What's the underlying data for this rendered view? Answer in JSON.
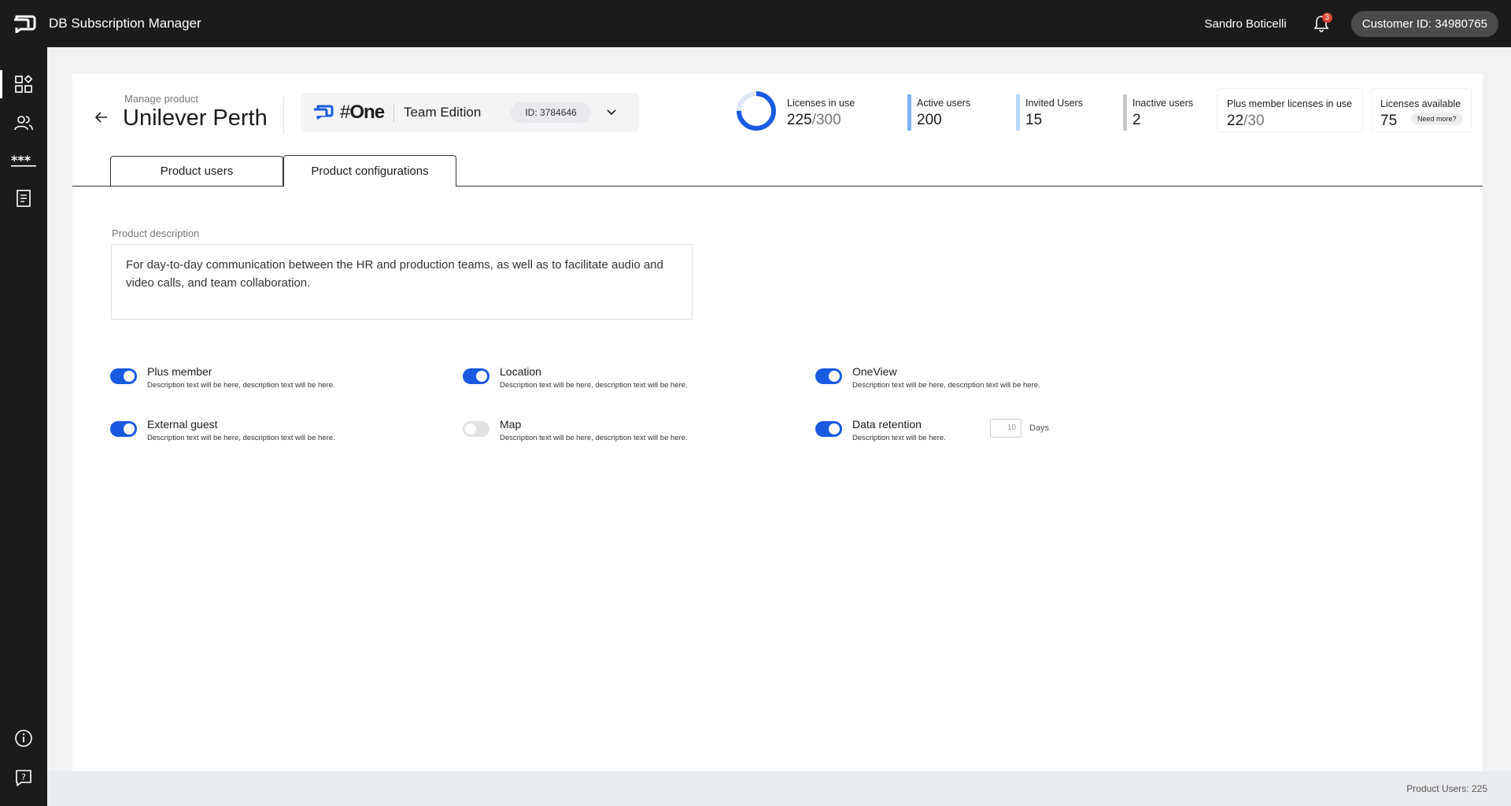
{
  "app": {
    "title": "DB Subscription Manager"
  },
  "header": {
    "user_name": "Sandro Boticelli",
    "notifications_count": "3",
    "customer_id": "Customer ID: 34980765"
  },
  "sidebar": {
    "items": [
      {
        "icon": "dashboard-icon"
      },
      {
        "icon": "users-icon"
      },
      {
        "icon": "password-icon"
      },
      {
        "icon": "invoice-icon"
      }
    ],
    "bottom": [
      {
        "icon": "info-icon"
      },
      {
        "icon": "help-icon"
      }
    ]
  },
  "product": {
    "manage_label": "Manage product",
    "name": "Unilever Perth",
    "brand_hash": "#",
    "brand_one": "One",
    "edition": "Team Edition",
    "id_label": "ID: 3784646"
  },
  "stats": {
    "licenses": {
      "label": "Licenses in use",
      "used": "225",
      "total": "/300",
      "fraction": 0.75
    },
    "active": {
      "label": "Active users",
      "value": "200"
    },
    "invited": {
      "label": "Invited Users",
      "value": "15"
    },
    "inactive": {
      "label": "Inactive users",
      "value": "2"
    },
    "plus": {
      "label": "Plus member licenses in use",
      "used": "22",
      "total": "/30"
    },
    "available": {
      "label": "Licenses available",
      "value": "75",
      "need_more": "Need more?"
    }
  },
  "colors": {
    "accent": "#1a5ae0",
    "active_bar": "#7fb3f5",
    "invited_bar": "#b9d6fb",
    "inactive_bar": "#c8c8c8"
  },
  "tabs": [
    {
      "label": "Product users",
      "active": false
    },
    {
      "label": "Product configurations",
      "active": true
    }
  ],
  "description": {
    "label": "Product description",
    "text": "For day-to-day communication between the HR and production teams, as well as to facilitate audio and video calls, and team collaboration."
  },
  "options": [
    {
      "name": "Plus member",
      "desc": "Description text will be here, description text will be here.",
      "on": true
    },
    {
      "name": "Location",
      "desc": "Description text will be here, description text will be here.",
      "on": true
    },
    {
      "name": "OneView",
      "desc": "Description text will be here, description text will be here.",
      "on": true
    },
    {
      "name": "External guest",
      "desc": "Description text will be here, description text will be here.",
      "on": true
    },
    {
      "name": "Map",
      "desc": "Description text will be here, description text will be here.",
      "on": false
    },
    {
      "name": "Data retention",
      "desc": "Description text will be here.",
      "on": true,
      "days_value": "10",
      "days_label": "Days"
    }
  ],
  "footer": {
    "count": "Product Users: 225"
  }
}
